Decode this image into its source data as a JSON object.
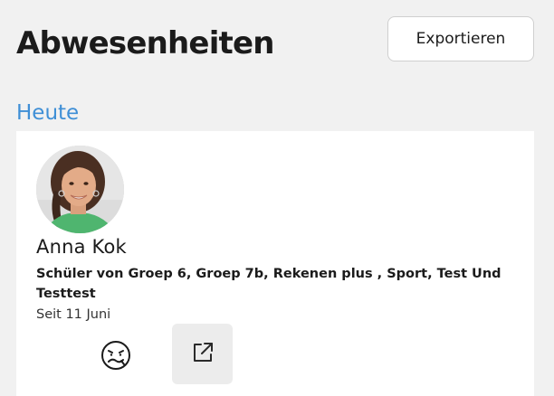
{
  "header": {
    "title": "Abwesenheiten",
    "export_label": "Exportieren"
  },
  "section": {
    "heading": "Heute"
  },
  "absence": {
    "name": "Anna Kok",
    "groups": "Schüler von Groep 6, Groep 7b, Rekenen plus , Sport, Test Und Testtest",
    "since": "Seit 11 Juni",
    "reason_icon": "sick-face-icon",
    "action_icon": "external-link-icon"
  },
  "colors": {
    "background": "#f1f1f1",
    "accent": "#3f8fd6",
    "card": "#ffffff",
    "action_bg": "#ececec"
  }
}
